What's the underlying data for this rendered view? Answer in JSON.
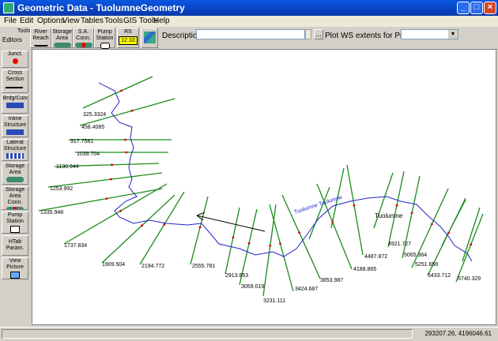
{
  "window": {
    "title": "Geometric Data - TuolumneGeometry"
  },
  "menu": [
    "File",
    "Edit",
    "Options",
    "View",
    "Tables",
    "Tools",
    "GIS Tools",
    "Help"
  ],
  "toolbar": {
    "editors_label": "Editors",
    "tools_label": "Tools",
    "river_reach": "River Reach",
    "storage_area": "Storage Area",
    "sa_conn": "S.A. Conn.",
    "pump_station": "Pump Station",
    "rs_label": "RS",
    "rs_value": "12.33",
    "description_label": "Description :",
    "description_value": "",
    "ellipsis": "...",
    "plot_ws_label": "Plot WS extents for Profile:",
    "profile_value": ""
  },
  "sidebar": [
    {
      "label": "Junct.",
      "glyph": "dot"
    },
    {
      "label": "Cross Section",
      "glyph": "xs"
    },
    {
      "label": "Brdg/Culv",
      "glyph": "bridge"
    },
    {
      "label": "Inline Structure",
      "glyph": "inline"
    },
    {
      "label": "Lateral Structure",
      "glyph": "lateral"
    },
    {
      "label": "Storage Area",
      "glyph": "green"
    },
    {
      "label": "Storage Area Conn.",
      "glyph": "conn"
    },
    {
      "label": "Pump Station",
      "glyph": "pump"
    },
    {
      "label": "HTab Param.",
      "glyph": "none"
    },
    {
      "label": "View Picture",
      "glyph": "pic"
    }
  ],
  "map": {
    "river_label": "Tuolumne",
    "reach_label": "Tuolumne  Tuolumne",
    "colors": {
      "river": "#2222cc",
      "xs": "#1a8c1a",
      "bank": "#dd0000"
    },
    "stations": [
      "325.3324",
      "458.4085",
      "917.7581",
      "1039.704",
      "1130.944",
      "1253.992",
      "1335.948",
      "1737.834",
      "1909.504",
      "2194.772",
      "2555.781",
      "2913.853",
      "3059.019",
      "3231.111",
      "3424.687",
      "3853.987",
      "4188.865",
      "4487.872",
      "4921.727",
      "5065.364",
      "5251.658",
      "5433.712",
      "5740.329"
    ]
  },
  "status": {
    "coords": "293207.26, 4196046.61"
  }
}
